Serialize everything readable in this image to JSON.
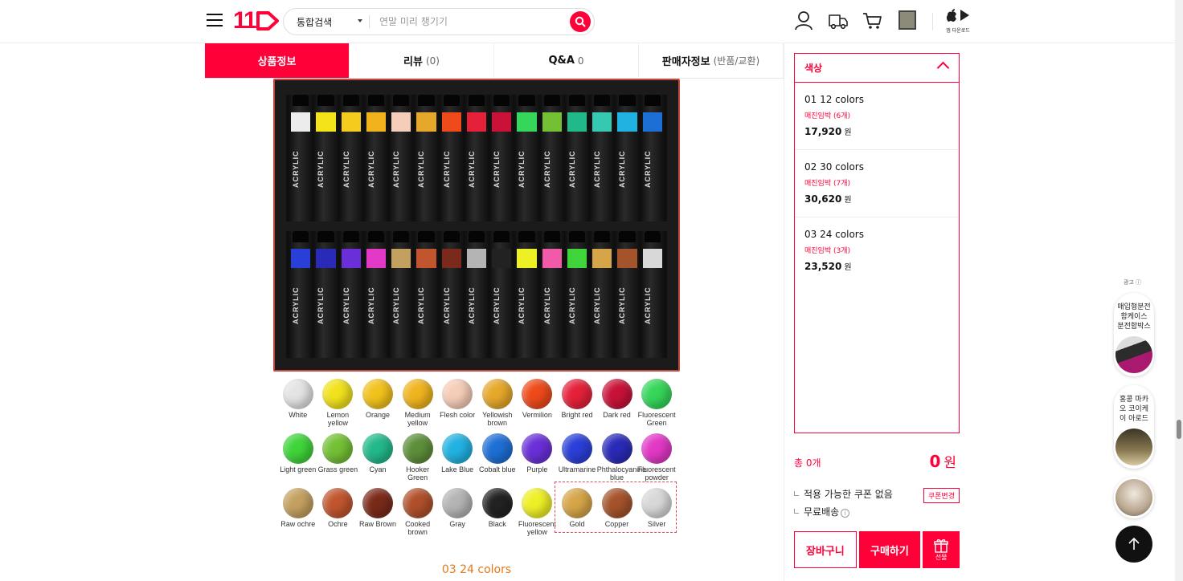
{
  "header": {
    "logo_text": "11",
    "search_category": "통합검색",
    "search_placeholder": "연말 미리 챙기기",
    "app_download_label": "앱 다운로드"
  },
  "tabs": [
    {
      "label": "상품정보",
      "count": ""
    },
    {
      "label": "리뷰",
      "count": "(0)"
    },
    {
      "label": "Q&A",
      "count": "0"
    },
    {
      "label": "판매자정보",
      "count": "(반품/교환)"
    }
  ],
  "product": {
    "swatches": [
      {
        "name": "White",
        "color": "#e4e4e4"
      },
      {
        "name": "Lemon yellow",
        "color": "#f2e21c"
      },
      {
        "name": "Orange",
        "color": "#f2c21c"
      },
      {
        "name": "Medium yellow",
        "color": "#f0b41e"
      },
      {
        "name": "Flesh color",
        "color": "#f6cdb8"
      },
      {
        "name": "Yellowish brown",
        "color": "#e6a82a"
      },
      {
        "name": "Vermilion",
        "color": "#ee4a1a"
      },
      {
        "name": "Bright red",
        "color": "#e5213a"
      },
      {
        "name": "Dark red",
        "color": "#c81238"
      },
      {
        "name": "Fluorescent Green",
        "color": "#35d65a"
      },
      {
        "name": "Light green",
        "color": "#3fd43a"
      },
      {
        "name": "Grass green",
        "color": "#74c035"
      },
      {
        "name": "Cyan",
        "color": "#22b98a"
      },
      {
        "name": "Hooker Green",
        "color": "#5d8f3a"
      },
      {
        "name": "Lake Blue",
        "color": "#21b2e2"
      },
      {
        "name": "Cobalt blue",
        "color": "#1d6fd6"
      },
      {
        "name": "Purple",
        "color": "#6a2fd8"
      },
      {
        "name": "Ultramarine",
        "color": "#2a3fd8"
      },
      {
        "name": "Phthalocyanine blue",
        "color": "#2a2ab8"
      },
      {
        "name": "Fluorescent powder",
        "color": "#e238c6"
      },
      {
        "name": "Raw ochre",
        "color": "#c4a060"
      },
      {
        "name": "Ochre",
        "color": "#c0552e"
      },
      {
        "name": "Raw Brown",
        "color": "#7a2a1a"
      },
      {
        "name": "Cooked brown",
        "color": "#b0502a"
      },
      {
        "name": "Gray",
        "color": "#b4b4b4"
      },
      {
        "name": "Black",
        "color": "#222222"
      },
      {
        "name": "Fluorescent yellow",
        "color": "#eef026"
      },
      {
        "name": "Gold",
        "color": "#d6a548"
      },
      {
        "name": "Copper",
        "color": "#a4532a"
      },
      {
        "name": "Silver",
        "color": "#d8d8d8"
      }
    ],
    "tray_top_colors": [
      "#ececec",
      "#f5e31a",
      "#f5cc1e",
      "#f2b21c",
      "#f6cdb8",
      "#e6a82a",
      "#ee4a1a",
      "#e5213a",
      "#c81238",
      "#35d65a",
      "#74c035",
      "#22b98a",
      "#34c9b0",
      "#21b2e2",
      "#1d6fd6"
    ],
    "tray_bottom_colors": [
      "#2a3fd8",
      "#2a2ab8",
      "#6a2fd8",
      "#e238c6",
      "#c4a060",
      "#c0552e",
      "#7a2a1a",
      "#b4b4b4",
      "#222222",
      "#eef026",
      "#f05aa8",
      "#3fd43a",
      "#d6a548",
      "#a4532a",
      "#d8d8d8"
    ],
    "tube_word": "ACRYLIC",
    "caption": "03 24 colors"
  },
  "options": {
    "header": "색상",
    "items": [
      {
        "name": "01 12 colors",
        "stock": "매진임박 (6개)",
        "price": "17,920",
        "unit": "원"
      },
      {
        "name": "02 30 colors",
        "stock": "매진임박 (7개)",
        "price": "30,620",
        "unit": "원"
      },
      {
        "name": "03 24 colors",
        "stock": "매진임박 (3개)",
        "price": "23,520",
        "unit": "원"
      }
    ]
  },
  "summary": {
    "total_label": "총 0개",
    "total_price": "0",
    "total_unit": "원",
    "coupon_text": "적용 가능한 쿠폰 없음",
    "coupon_button": "쿠폰변경",
    "shipping_text": "무료배송"
  },
  "actions": {
    "cart": "장바구니",
    "buy": "구매하기",
    "gift": "선물"
  },
  "ads": {
    "label": "광고",
    "cards": [
      {
        "text": "매입형분전 함케이스 분전함박스",
        "color": "#2c2c2c"
      },
      {
        "text": "홍콩 마카 오 코이케 이 아로드",
        "color": "#6b5a3a"
      },
      {
        "text": "",
        "color": "#b9a68f"
      }
    ]
  },
  "colors": {
    "accent": "#ff0038"
  }
}
